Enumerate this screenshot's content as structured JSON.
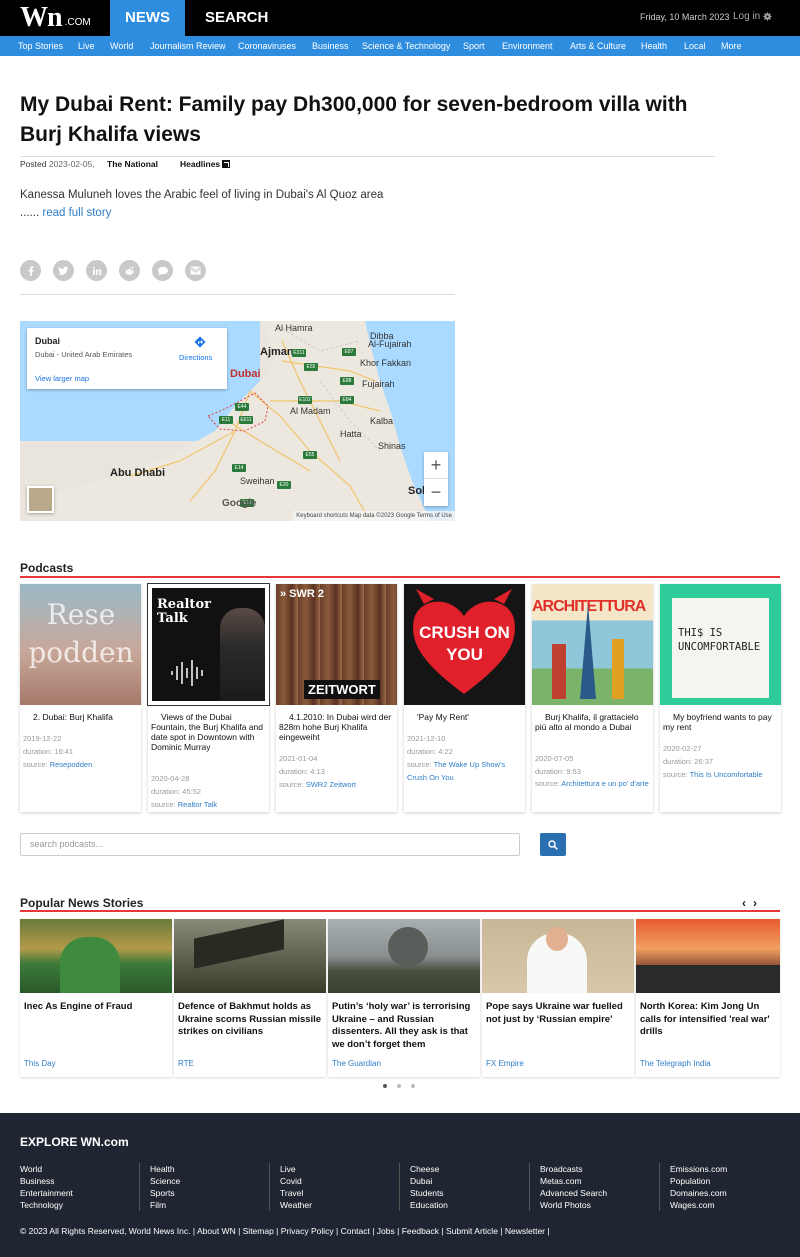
{
  "header": {
    "logo_text": "Wn",
    "logo_suffix": ".COM",
    "nav_news": "NEWS",
    "nav_search": "SEARCH",
    "date": "Friday, 10 March 2023",
    "login": "Log in"
  },
  "categories": [
    "Top Stories",
    "Live",
    "World",
    "Journalism Review",
    "Coronaviruses",
    "Business",
    "Science & Technology",
    "Sport",
    "Environment",
    "Arts & Culture",
    "Health",
    "Local",
    "More"
  ],
  "article": {
    "title": "My Dubai Rent: Family pay Dh300,000 for seven-bedroom villa with Burj Khalifa views",
    "posted_label": "Posted",
    "posted_date": "2023-02-05,",
    "source": "The National",
    "headlines": "Headlines",
    "summary": "Kanessa Muluneh loves the Arabic feel of living in Dubai's Al Quoz area",
    "ellipsis": "......",
    "read_more": "read full story"
  },
  "share_icons": [
    "facebook-icon",
    "twitter-icon",
    "linkedin-icon",
    "reddit-icon",
    "comment-icon",
    "email-icon"
  ],
  "map": {
    "place": "Dubai",
    "place_sub": "Dubai - United Arab Emirates",
    "directions": "Directions",
    "view_larger": "View larger map",
    "zoom_in": "+",
    "zoom_out": "−",
    "footer": "Keyboard shortcuts   Map data ©2023 Google   Terms of Use",
    "google": "Google",
    "labels": {
      "al_hamra": "Al Hamra",
      "ajman": "Ajman",
      "dibba": "Dibba",
      "al_fujairah": "Al-Fujairah",
      "khor_fakkan": "Khor Fakkan",
      "fujairah": "Fujairah",
      "dubai": "Dubai",
      "al_madam": "Al Madam",
      "kalba": "Kalba",
      "hatta": "Hatta",
      "shinas": "Shinas",
      "abu_dhabi": "Abu Dhabi",
      "sweihan": "Sweihan",
      "sohar": "Sol"
    }
  },
  "podcasts": {
    "title": "Podcasts",
    "search_placeholder": "search podcasts...",
    "items": [
      {
        "title": "2. Dubai: Burj Khalifa",
        "date": "2019-12-22",
        "duration": "duration: 16:41",
        "source_label": "source:",
        "source": "Resepodden",
        "art": "Rese podden"
      },
      {
        "title": "Views of the Dubai Fountain, the Burj Khalifa and date spot in Downtown with Dominic Murray",
        "date": "2020-04-28",
        "duration": "duration: 45:52",
        "source_label": "source:",
        "source": "Realtor Talk",
        "art": "Realtor Talk"
      },
      {
        "title": "4.1.2010: In Dubai wird der 828m hohe Burj Khalifa eingeweiht",
        "date": "2021-01-04",
        "duration": "duration: 4:13",
        "source_label": "source:",
        "source": "SWR2 Zeitwort",
        "art": "ZEITWORT"
      },
      {
        "title": "'Pay My Rent'",
        "date": "2021-12-10",
        "duration": "duration: 4:22",
        "source_label": "source:",
        "source": "The Wake Up Show's Crush On You",
        "art": "CRUSH ON YOU"
      },
      {
        "title": "Burj Khalifa, il grattacielo più alto al mondo a Dubai",
        "date": "2020-07-05",
        "duration": "duration: 9:53",
        "source_label": "source:",
        "source": "Architettura e un po' d'arte",
        "art": "ARCHITETTURA"
      },
      {
        "title": "My boyfriend wants to pay my rent",
        "date": "2020-02-27",
        "duration": "duration: 26:37",
        "source_label": "source:",
        "source": "This Is Uncomfortable",
        "art": "THI$ IS UNCOMFORTABLE"
      }
    ]
  },
  "popular": {
    "title": "Popular News Stories",
    "items": [
      {
        "title": "Inec As Engine of Fraud",
        "source": "This Day"
      },
      {
        "title": "Defence of Bakhmut holds as Ukraine scorns Russian missile strikes on civilians",
        "source": "RTE"
      },
      {
        "title": "Putin’s ‘holy war’ is terrorising Ukraine – and Russian dissenters. All they ask is that we don’t forget them",
        "source": "The Guardian"
      },
      {
        "title": "Pope says Ukraine war fuelled not just by ‘Russian empire’",
        "source": "FX Empire"
      },
      {
        "title": "North Korea: Kim Jong Un calls for intensified 'real war' drills",
        "source": "The Telegraph India"
      }
    ]
  },
  "footer": {
    "title": "EXPLORE WN.com",
    "columns": [
      [
        "World",
        "Business",
        "Entertainment",
        "Technology"
      ],
      [
        "Health",
        "Science",
        "Sports",
        "Film"
      ],
      [
        "Live",
        "Covid",
        "Travel",
        "Weather"
      ],
      [
        "Cheese",
        "Dubai",
        "Students",
        "Education"
      ],
      [
        "Broadcasts",
        "Metas.com",
        "Advanced Search",
        "World Photos"
      ],
      [
        "Emissions.com",
        "Population",
        "Domaines.com",
        "Wages.com"
      ]
    ],
    "links": "© 2023 All Rights Reserved, World News Inc. | About WN | Sitemap | Privacy Policy | Contact | Jobs | Feedback | Submit Article | Newsletter |"
  },
  "colors": {
    "accent_blue": "#2f8de0",
    "section_red": "#e53935",
    "footer_bg": "#202631"
  }
}
